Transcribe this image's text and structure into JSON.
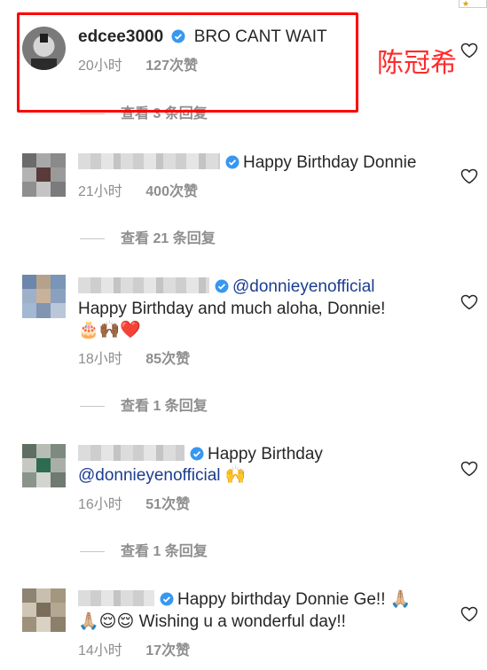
{
  "annotation": {
    "text": "陈冠希"
  },
  "comments": [
    {
      "username": "edcee3000",
      "text": "BRO CANT WAIT",
      "time": "20小时",
      "likes": "127次赞",
      "replies": "查看 3 条回复"
    },
    {
      "text": "Happy Birthday Donnie",
      "time": "21小时",
      "likes": "400次赞",
      "replies": "查看 21 条回复"
    },
    {
      "mention": "@donnieyenofficial",
      "text": "Happy Birthday and much aloha, Donnie!",
      "emojis": "🎂🙌🏾❤️",
      "time": "18小时",
      "likes": "85次赞",
      "replies": "查看 1 条回复"
    },
    {
      "text": "Happy Birthday",
      "mention": "@donnieyenofficial",
      "emojis": "🙌",
      "time": "16小时",
      "likes": "51次赞",
      "replies": "查看 1 条回复"
    },
    {
      "text": "Happy birthday Donnie Ge!! 🙏🏼",
      "text2_prefix": "🙏🏼😌😌",
      "text2": "Wishing u a wonderful day!!",
      "time": "14小时",
      "likes": "17次赞"
    }
  ],
  "icons": {
    "verified": "verified-badge-icon",
    "like": "heart-outline-icon"
  },
  "colors": {
    "highlight": "#ff0000",
    "annotation": "#ff2a2a",
    "verified": "#3897f0",
    "mention": "#1a3d8f",
    "meta": "#8e8e8e"
  }
}
